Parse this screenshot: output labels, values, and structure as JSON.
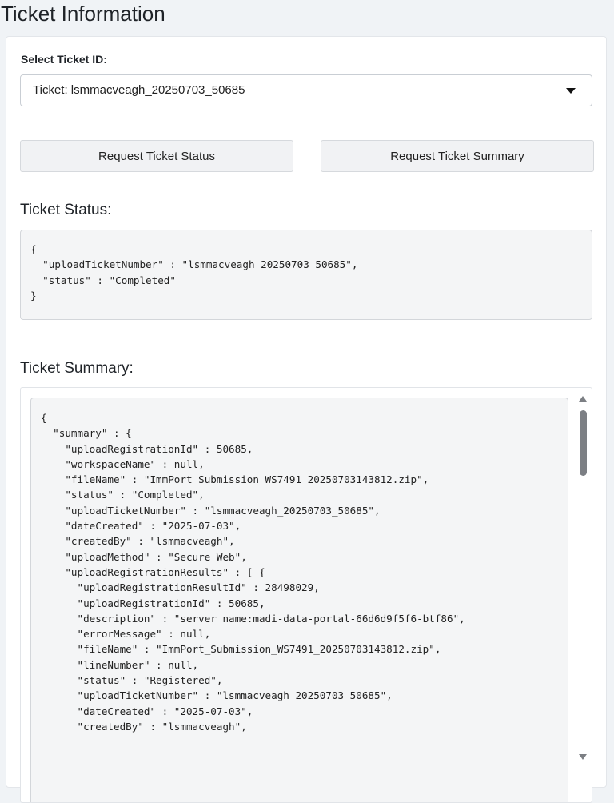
{
  "page": {
    "title": "Ticket Information"
  },
  "selector": {
    "label": "Select Ticket ID:",
    "value": "Ticket: lsmmacveagh_20250703_50685"
  },
  "buttons": {
    "status_label": "Request Ticket Status",
    "summary_label": "Request Ticket Summary"
  },
  "status_section": {
    "heading": "Ticket Status:",
    "json_text": "{\n  \"uploadTicketNumber\" : \"lsmmacveagh_20250703_50685\",\n  \"status\" : \"Completed\"\n}"
  },
  "summary_section": {
    "heading": "Ticket Summary:",
    "json_text": "{\n  \"summary\" : {\n    \"uploadRegistrationId\" : 50685,\n    \"workspaceName\" : null,\n    \"fileName\" : \"ImmPort_Submission_WS7491_20250703143812.zip\",\n    \"status\" : \"Completed\",\n    \"uploadTicketNumber\" : \"lsmmacveagh_20250703_50685\",\n    \"dateCreated\" : \"2025-07-03\",\n    \"createdBy\" : \"lsmmacveagh\",\n    \"uploadMethod\" : \"Secure Web\",\n    \"uploadRegistrationResults\" : [ {\n      \"uploadRegistrationResultId\" : 28498029,\n      \"uploadRegistrationId\" : 50685,\n      \"description\" : \"server name:madi-data-portal-66d6d9f5f6-btf86\",\n      \"errorMessage\" : null,\n      \"fileName\" : \"ImmPort_Submission_WS7491_20250703143812.zip\",\n      \"lineNumber\" : null,\n      \"status\" : \"Registered\",\n      \"uploadTicketNumber\" : \"lsmmacveagh_20250703_50685\",\n      \"dateCreated\" : \"2025-07-03\",\n      \"createdBy\" : \"lsmmacveagh\","
  },
  "icons": {
    "dropdown": "caret-down-icon",
    "scroll_up": "scroll-up-arrow-icon",
    "scroll_down": "scroll-down-arrow-icon"
  }
}
